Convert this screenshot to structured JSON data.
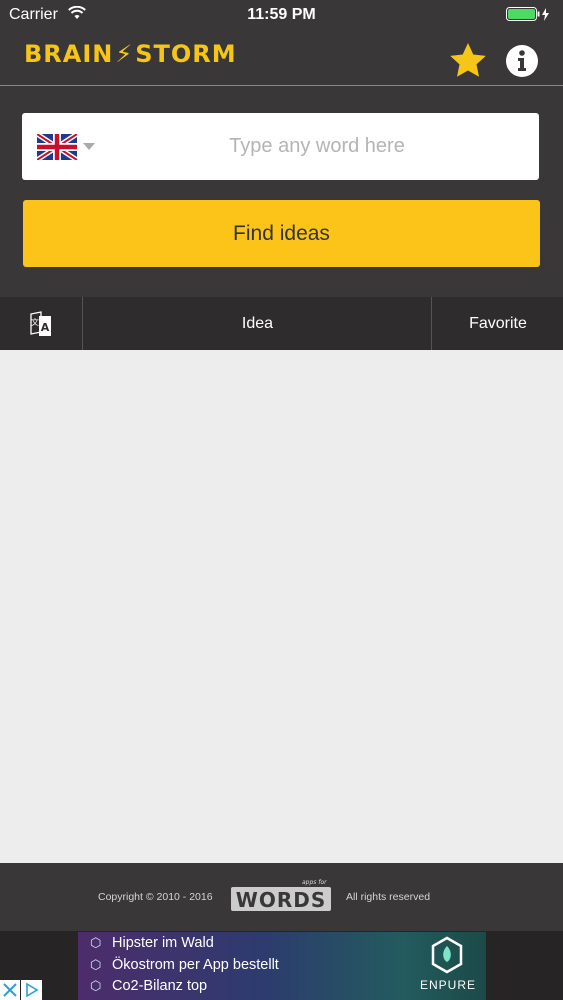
{
  "status_bar": {
    "carrier": "Carrier",
    "time": "11:59 PM"
  },
  "header": {
    "logo_left": "BRAIN",
    "logo_right": "STORM",
    "favorites_icon": "star-icon",
    "info_icon": "info-icon"
  },
  "search": {
    "placeholder": "Type any word here",
    "value": "",
    "language_flag": "uk-flag-icon"
  },
  "find_button": {
    "label": "Find ideas"
  },
  "tabs": [
    {
      "label": "",
      "icon": "translate-icon"
    },
    {
      "label": "Idea"
    },
    {
      "label": "Favorite"
    }
  ],
  "footer": {
    "copyright": "Copyright © 2010 - 2016",
    "logo_small": "apps for",
    "logo": "WORDS",
    "rights": "All rights reserved"
  },
  "ad": {
    "lines": [
      "Hipster im Wald",
      "Ökostrom per App bestellt",
      "Co2-Bilanz top"
    ],
    "brand": "ENPURE"
  },
  "colors": {
    "background": "#3a3738",
    "accent": "#fcc419",
    "logo": "#f5c518",
    "content": "#eeedee"
  }
}
